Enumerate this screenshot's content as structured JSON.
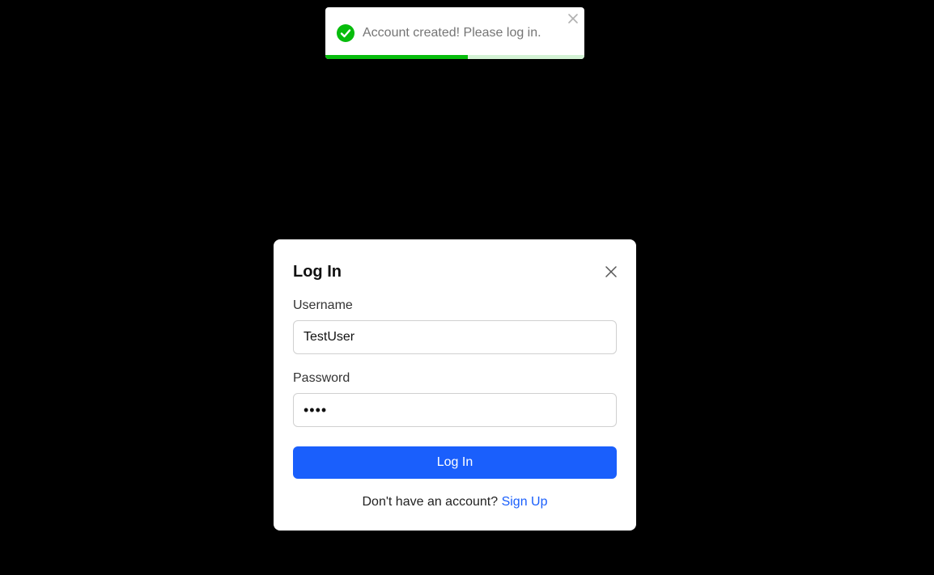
{
  "colors": {
    "page_background": "#000000",
    "success_green": "#07bc0c",
    "primary_blue": "#1a5ffc",
    "link_blue": "#1a5ffc"
  },
  "toast": {
    "icon": "check-circle-icon",
    "message": "Account created! Please log in.",
    "close_icon": "close-icon",
    "progress": 0.55
  },
  "login_modal": {
    "title": "Log In",
    "close_icon": "close-icon",
    "username": {
      "label": "Username",
      "value": "TestUser"
    },
    "password": {
      "label": "Password",
      "value": "••••"
    },
    "submit_label": "Log In",
    "footer": {
      "prompt": "Don't have an account?",
      "link_label": "Sign Up"
    }
  }
}
